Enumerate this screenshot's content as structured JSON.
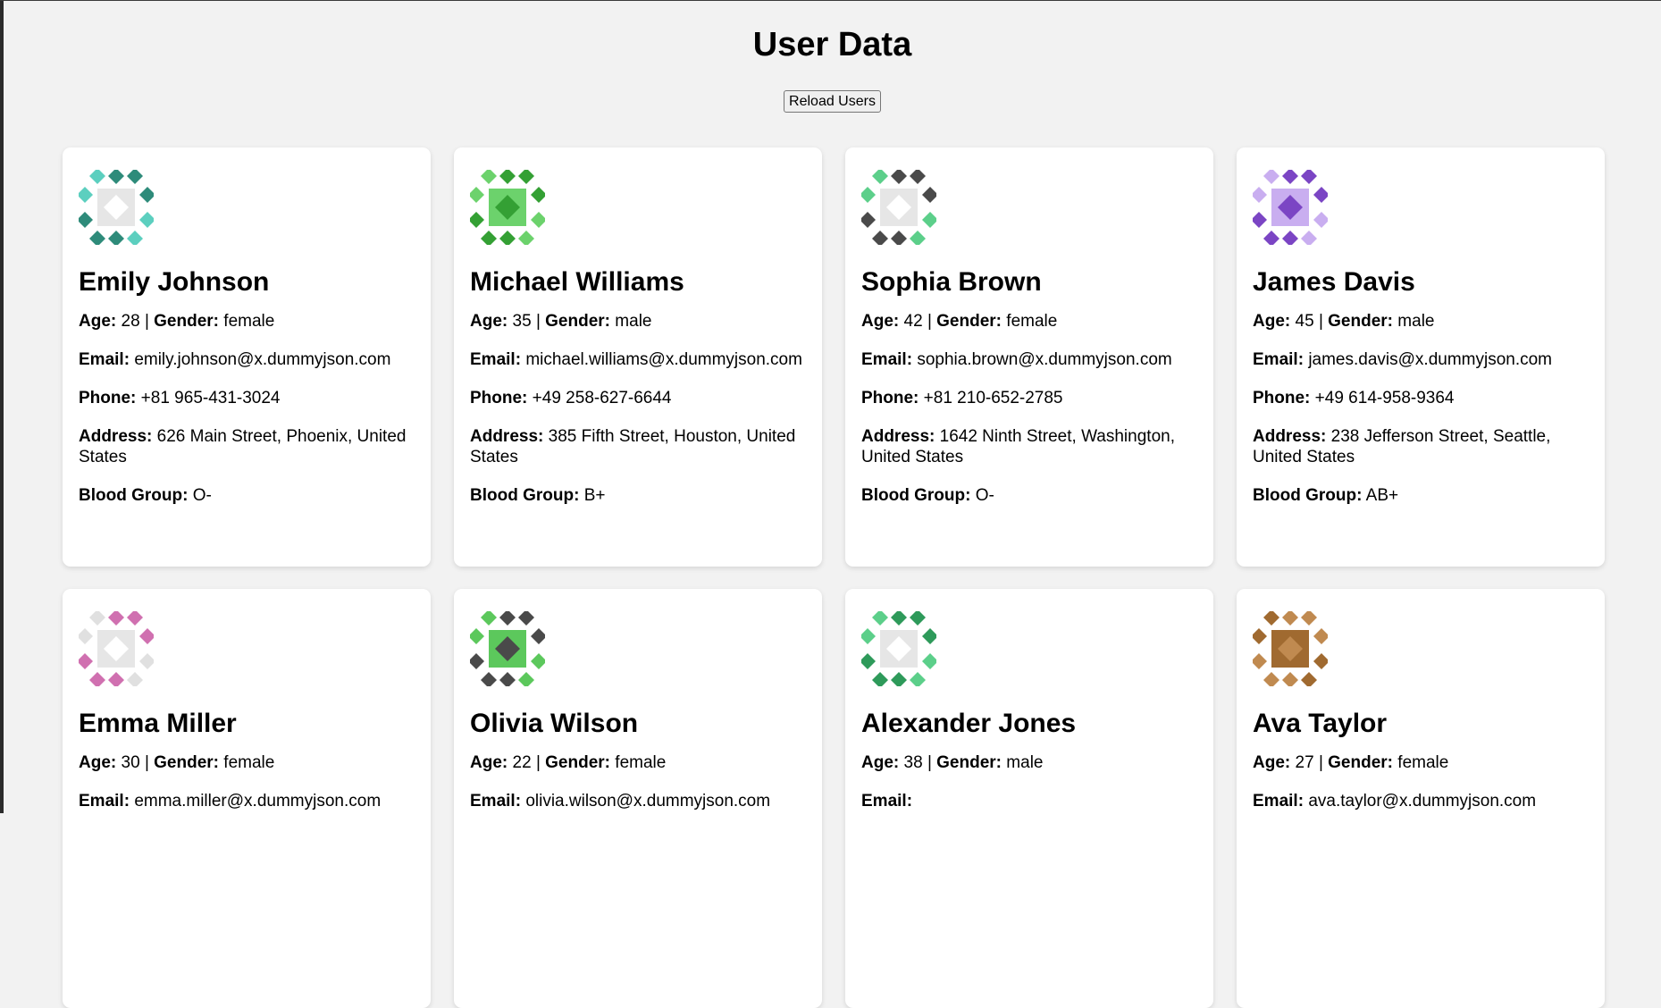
{
  "page": {
    "title": "User Data",
    "reload_label": "Reload Users"
  },
  "labels": {
    "age": "Age:",
    "gender": "Gender:",
    "email": "Email:",
    "phone": "Phone:",
    "address": "Address:",
    "blood": "Blood Group:",
    "separator": "|"
  },
  "users": [
    {
      "name": "Emily Johnson",
      "age": "28",
      "gender": "female",
      "email": "emily.johnson@x.dummyjson.com",
      "phone": "+81 965-431-3024",
      "address": "626 Main Street, Phoenix, United States",
      "blood": "O-",
      "avatar_color": "#2e8b7a",
      "avatar_accent": "#5ccfbf"
    },
    {
      "name": "Michael Williams",
      "age": "35",
      "gender": "male",
      "email": "michael.williams@x.dummyjson.com",
      "phone": "+49 258-627-6644",
      "address": "385 Fifth Street, Houston, United States",
      "blood": "B+",
      "avatar_color": "#34a034",
      "avatar_accent": "#6cd26c"
    },
    {
      "name": "Sophia Brown",
      "age": "42",
      "gender": "female",
      "email": "sophia.brown@x.dummyjson.com",
      "phone": "+81 210-652-2785",
      "address": "1642 Ninth Street, Washington, United States",
      "blood": "O-",
      "avatar_color": "#4a4a4a",
      "avatar_accent": "#5ccf8a"
    },
    {
      "name": "James Davis",
      "age": "45",
      "gender": "male",
      "email": "james.davis@x.dummyjson.com",
      "phone": "+49 614-958-9364",
      "address": "238 Jefferson Street, Seattle, United States",
      "blood": "AB+",
      "avatar_color": "#7b45c4",
      "avatar_accent": "#c9aef0"
    },
    {
      "name": "Emma Miller",
      "age": "30",
      "gender": "female",
      "email": "emma.miller@x.dummyjson.com",
      "avatar_color": "#d070b0",
      "avatar_accent": "#e0e0e0"
    },
    {
      "name": "Olivia Wilson",
      "age": "22",
      "gender": "female",
      "email": "olivia.wilson@x.dummyjson.com",
      "avatar_color": "#4a4a4a",
      "avatar_accent": "#5cc85c"
    },
    {
      "name": "Alexander Jones",
      "age": "38",
      "gender": "male",
      "email": "",
      "avatar_color": "#2e9a5a",
      "avatar_accent": "#5ccf8a"
    },
    {
      "name": "Ava Taylor",
      "age": "27",
      "gender": "female",
      "email": "ava.taylor@x.dummyjson.com",
      "avatar_color": "#c08a50",
      "avatar_accent": "#a06a30"
    }
  ]
}
